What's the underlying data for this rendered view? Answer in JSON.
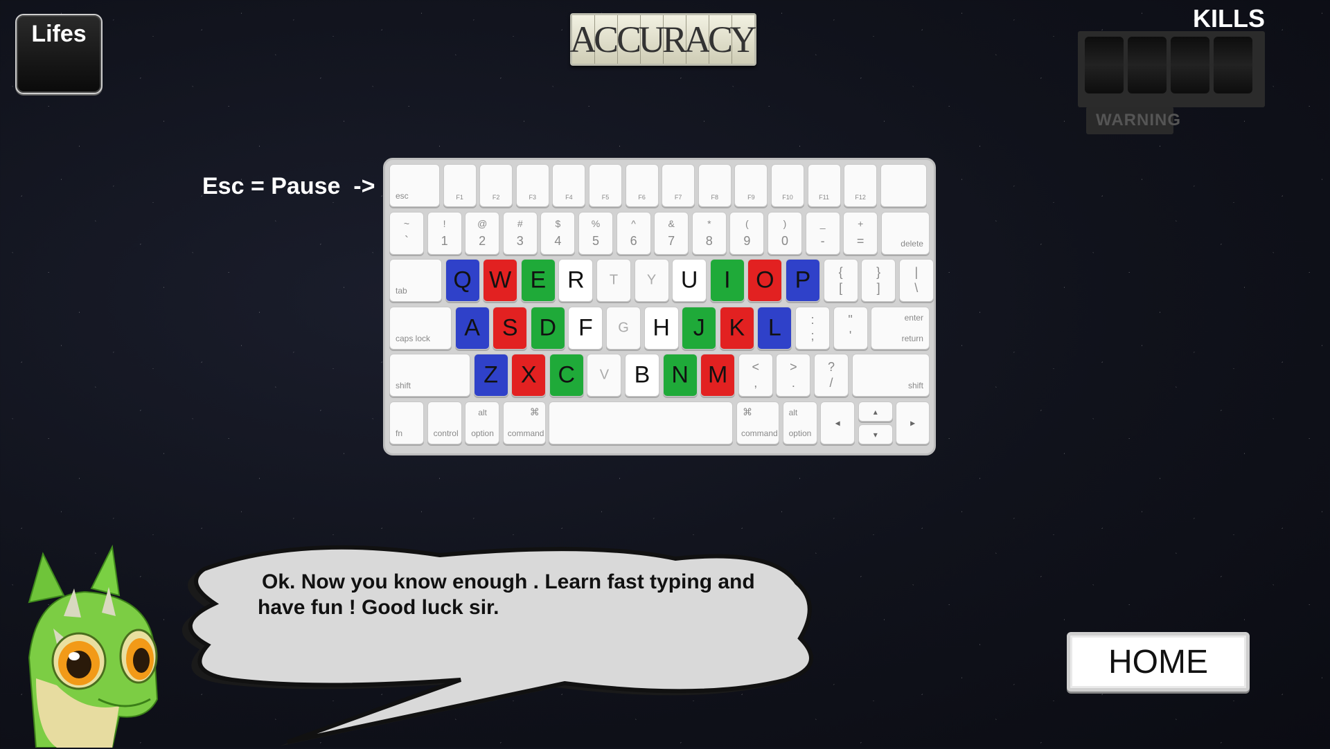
{
  "hud": {
    "lifes_label": "Lifes",
    "accuracy_letters": [
      "A",
      "C",
      "C",
      "U",
      "R",
      "A",
      "C",
      "Y"
    ],
    "kills_label": "KILLS",
    "warning_label": "WARNING"
  },
  "esc_hint": "Esc = Pause  ->",
  "keyboard": {
    "fn_row": {
      "esc": "esc",
      "f_labels": [
        "F1",
        "F2",
        "F3",
        "F4",
        "F5",
        "F6",
        "F7",
        "F8",
        "F9",
        "F10",
        "F11",
        "F12"
      ]
    },
    "num_row": [
      {
        "top": "~",
        "bot": "`"
      },
      {
        "top": "!",
        "bot": "1"
      },
      {
        "top": "@",
        "bot": "2"
      },
      {
        "top": "#",
        "bot": "3"
      },
      {
        "top": "$",
        "bot": "4"
      },
      {
        "top": "%",
        "bot": "5"
      },
      {
        "top": "^",
        "bot": "6"
      },
      {
        "top": "&",
        "bot": "7"
      },
      {
        "top": "*",
        "bot": "8"
      },
      {
        "top": "(",
        "bot": "9"
      },
      {
        "top": ")",
        "bot": "0"
      },
      {
        "top": "_",
        "bot": "-"
      },
      {
        "top": "+",
        "bot": "="
      }
    ],
    "delete": "delete",
    "tab": "tab",
    "qwerty_row": [
      {
        "k": "Q",
        "c": "blue"
      },
      {
        "k": "W",
        "c": "red"
      },
      {
        "k": "E",
        "c": "green"
      },
      {
        "k": "R",
        "c": "white"
      },
      {
        "k": "T",
        "c": "dim"
      },
      {
        "k": "Y",
        "c": "dim"
      },
      {
        "k": "U",
        "c": "white"
      },
      {
        "k": "I",
        "c": "green"
      },
      {
        "k": "O",
        "c": "red"
      },
      {
        "k": "P",
        "c": "blue"
      }
    ],
    "bracket_keys": [
      {
        "top": "{",
        "bot": "["
      },
      {
        "top": "}",
        "bot": "]"
      },
      {
        "top": "|",
        "bot": "\\"
      }
    ],
    "caps": "caps lock",
    "asdf_row": [
      {
        "k": "A",
        "c": "blue"
      },
      {
        "k": "S",
        "c": "red"
      },
      {
        "k": "D",
        "c": "green"
      },
      {
        "k": "F",
        "c": "white"
      },
      {
        "k": "G",
        "c": "dim"
      },
      {
        "k": "H",
        "c": "white"
      },
      {
        "k": "J",
        "c": "green"
      },
      {
        "k": "K",
        "c": "red"
      },
      {
        "k": "L",
        "c": "blue"
      }
    ],
    "semi_keys": [
      {
        "top": ":",
        "bot": ";"
      },
      {
        "top": "\"",
        "bot": "'"
      }
    ],
    "enter_top": "enter",
    "enter_bot": "return",
    "shift": "shift",
    "zxcv_row": [
      {
        "k": "Z",
        "c": "blue"
      },
      {
        "k": "X",
        "c": "red"
      },
      {
        "k": "C",
        "c": "green"
      },
      {
        "k": "V",
        "c": "dim"
      },
      {
        "k": "B",
        "c": "white"
      },
      {
        "k": "N",
        "c": "green"
      },
      {
        "k": "M",
        "c": "red"
      }
    ],
    "punct_keys": [
      {
        "top": "<",
        "bot": ","
      },
      {
        "top": ">",
        "bot": "."
      },
      {
        "top": "?",
        "bot": "/"
      }
    ],
    "bottom_row": {
      "fn": "fn",
      "control": "control",
      "alt": "alt",
      "option": "option",
      "cmd_symbol": "⌘",
      "command": "command",
      "left": "◂",
      "up": "▴",
      "down": "▾",
      "right": "▸"
    }
  },
  "dialog": {
    "line1": "Ok. Now you know enough . Learn fast typing and",
    "line2": "have fun ! Good luck sir."
  },
  "home_button": "HOME",
  "colors": {
    "blue": "#2f41c9",
    "red": "#e22121",
    "green": "#1faa39"
  }
}
